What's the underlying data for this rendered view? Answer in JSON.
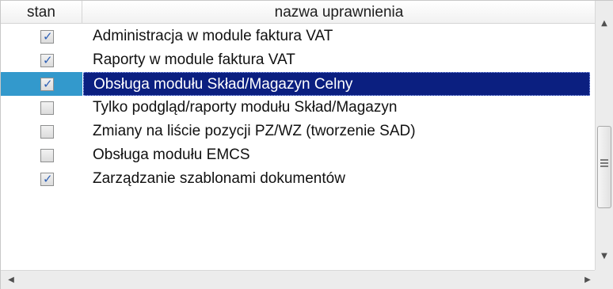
{
  "columns": {
    "stan": "stan",
    "name": "nazwa uprawnienia"
  },
  "rows": [
    {
      "checked": true,
      "label": "Administracja w module faktura VAT",
      "selected": false
    },
    {
      "checked": true,
      "label": "Raporty w module faktura VAT",
      "selected": false
    },
    {
      "checked": true,
      "label": "Obsługa modułu Skład/Magazyn Celny",
      "selected": true
    },
    {
      "checked": false,
      "label": "Tylko podgląd/raporty modułu Skład/Magazyn",
      "selected": false
    },
    {
      "checked": false,
      "label": "Zmiany na liście pozycji PZ/WZ (tworzenie SAD)",
      "selected": false
    },
    {
      "checked": false,
      "label": "Obsługa modułu EMCS",
      "selected": false
    },
    {
      "checked": true,
      "label": "Zarządzanie szablonami dokumentów",
      "selected": false
    }
  ],
  "icons": {
    "check": "✓",
    "scroll_up": "▲",
    "scroll_down": "▼",
    "scroll_left": "◀",
    "scroll_right": "▶"
  },
  "colors": {
    "selection": "#0b1f80",
    "selection_check_cell": "#3399cc"
  }
}
